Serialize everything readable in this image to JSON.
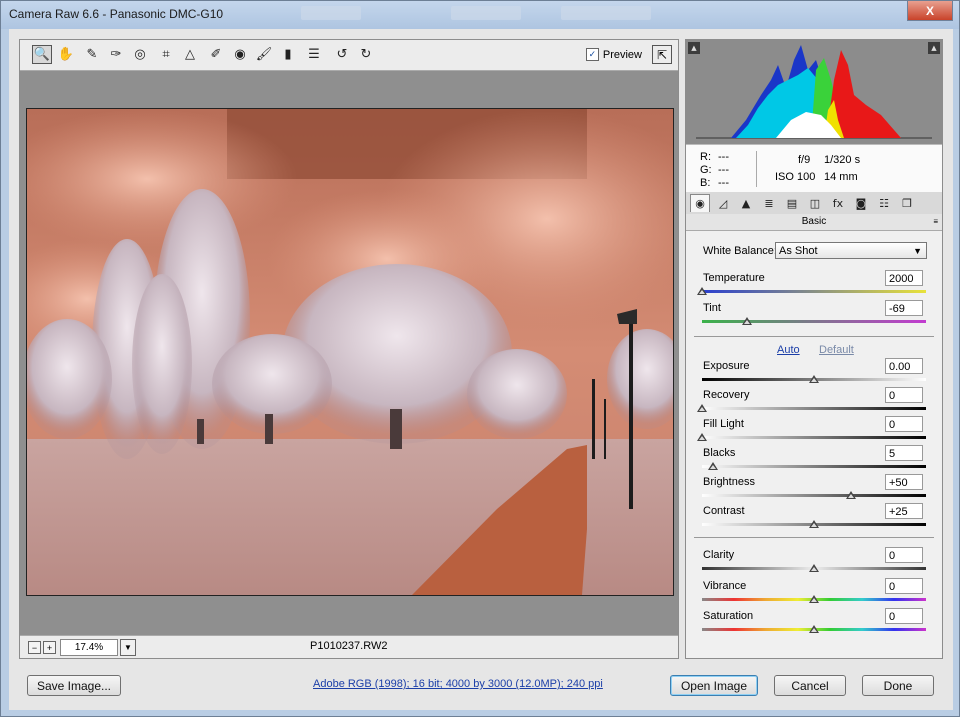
{
  "window": {
    "title": "Camera Raw 6.6  -  Panasonic DMC-G10",
    "close_glyph": "X"
  },
  "toolbar": {
    "tools": [
      {
        "name": "zoom-tool-icon",
        "glyph": "🔍"
      },
      {
        "name": "hand-tool-icon",
        "glyph": "✋"
      },
      {
        "name": "white-balance-tool-icon",
        "glyph": "✎"
      },
      {
        "name": "color-sampler-tool-icon",
        "glyph": "✑"
      },
      {
        "name": "targeted-adjustment-tool-icon",
        "glyph": "◎"
      },
      {
        "name": "crop-tool-icon",
        "glyph": "⌗"
      },
      {
        "name": "straighten-tool-icon",
        "glyph": "△"
      },
      {
        "name": "spot-removal-tool-icon",
        "glyph": "✐"
      },
      {
        "name": "red-eye-tool-icon",
        "glyph": "◉"
      },
      {
        "name": "adjustment-brush-icon",
        "glyph": "🖌"
      },
      {
        "name": "graduated-filter-icon",
        "glyph": "▮"
      },
      {
        "name": "preferences-icon",
        "glyph": "☰"
      },
      {
        "name": "rotate-left-icon",
        "glyph": "↺"
      },
      {
        "name": "rotate-right-icon",
        "glyph": "↻"
      }
    ],
    "preview_label": "Preview",
    "preview_checked": true
  },
  "image_area": {
    "zoom_value": "17.4%",
    "filename": "P1010237.RW2"
  },
  "info": {
    "r_label": "R:",
    "r_value": "---",
    "g_label": "G:",
    "g_value": "---",
    "b_label": "B:",
    "b_value": "---",
    "aperture": "f/9",
    "shutter": "1/320 s",
    "iso": "ISO 100",
    "focal": "14 mm"
  },
  "tabs": [
    {
      "name": "tab-basic",
      "glyph": "◉"
    },
    {
      "name": "tab-tone-curve",
      "glyph": "◿"
    },
    {
      "name": "tab-detail",
      "glyph": "▲"
    },
    {
      "name": "tab-hsl",
      "glyph": "≣"
    },
    {
      "name": "tab-split-toning",
      "glyph": "▤"
    },
    {
      "name": "tab-lens-corrections",
      "glyph": "◫"
    },
    {
      "name": "tab-effects",
      "glyph": "fx"
    },
    {
      "name": "tab-camera-calibration",
      "glyph": "◙"
    },
    {
      "name": "tab-presets",
      "glyph": "☷"
    },
    {
      "name": "tab-snapshots",
      "glyph": "❐"
    }
  ],
  "panel": {
    "title": "Basic",
    "menu_glyph": "≡",
    "white_balance_label": "White Balance:",
    "white_balance_value": "As Shot",
    "auto_label": "Auto",
    "default_label": "Default"
  },
  "sliders": [
    {
      "label": "Temperature",
      "value": "2000",
      "fraction": 0.0
    },
    {
      "label": "Tint",
      "value": "-69",
      "fraction": 0.2
    },
    {
      "label": "Exposure",
      "value": "0.00",
      "fraction": 0.5
    },
    {
      "label": "Recovery",
      "value": "0",
      "fraction": 0.0
    },
    {
      "label": "Fill Light",
      "value": "0",
      "fraction": 0.0
    },
    {
      "label": "Blacks",
      "value": "5",
      "fraction": 0.05
    },
    {
      "label": "Brightness",
      "value": "+50",
      "fraction": 0.665
    },
    {
      "label": "Contrast",
      "value": "+25",
      "fraction": 0.5
    },
    {
      "label": "Clarity",
      "value": "0",
      "fraction": 0.5
    },
    {
      "label": "Vibrance",
      "value": "0",
      "fraction": 0.5
    },
    {
      "label": "Saturation",
      "value": "0",
      "fraction": 0.5
    }
  ],
  "footer": {
    "save_label": "Save Image...",
    "workflow_link": "Adobe RGB (1998); 16 bit; 4000 by 3000 (12.0MP); 240 ppi",
    "open_label": "Open Image",
    "cancel_label": "Cancel",
    "done_label": "Done"
  },
  "colors": {
    "sky": "#c8806a",
    "accent_link": "#1c3fa8"
  }
}
